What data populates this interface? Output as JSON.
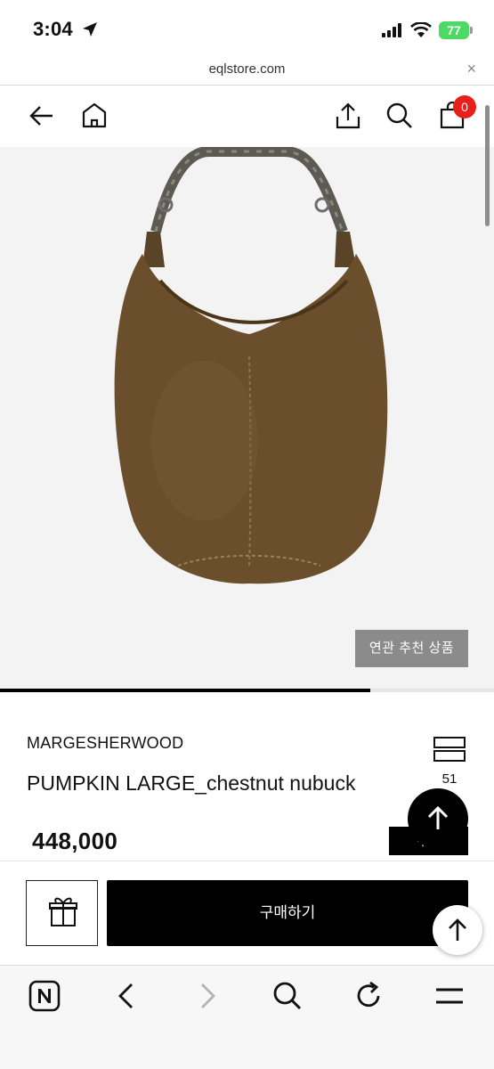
{
  "status_bar": {
    "time": "3:04",
    "battery": "77",
    "battery_color": "#4cd964",
    "icons": [
      "location-arrow-icon",
      "signal-bars-icon",
      "wifi-icon",
      "battery-icon"
    ]
  },
  "browser": {
    "url": "eqlstore.com",
    "close_glyph": "×"
  },
  "header": {
    "icons": [
      "back-arrow-icon",
      "home-icon",
      "share-icon",
      "search-icon",
      "cart-icon"
    ],
    "cart_count": "0",
    "badge_color": "#e8201b"
  },
  "gallery": {
    "related_button": "연관 추천 상품",
    "progress": 0.75
  },
  "product": {
    "brand": "MARGESHERWOOD",
    "name": "PUMPKIN LARGE_chestnut nubuck",
    "price": "448,000",
    "like_count": "51",
    "coupon_label": "쿠폰"
  },
  "actions": {
    "buy_label": "구매하기",
    "icons": [
      "gift-icon",
      "arrow-up-icon"
    ]
  },
  "toolbar": {
    "icons": [
      "naver-n-icon",
      "back-chevron-icon",
      "forward-chevron-icon",
      "search-icon",
      "reload-icon",
      "menu-icon"
    ]
  }
}
